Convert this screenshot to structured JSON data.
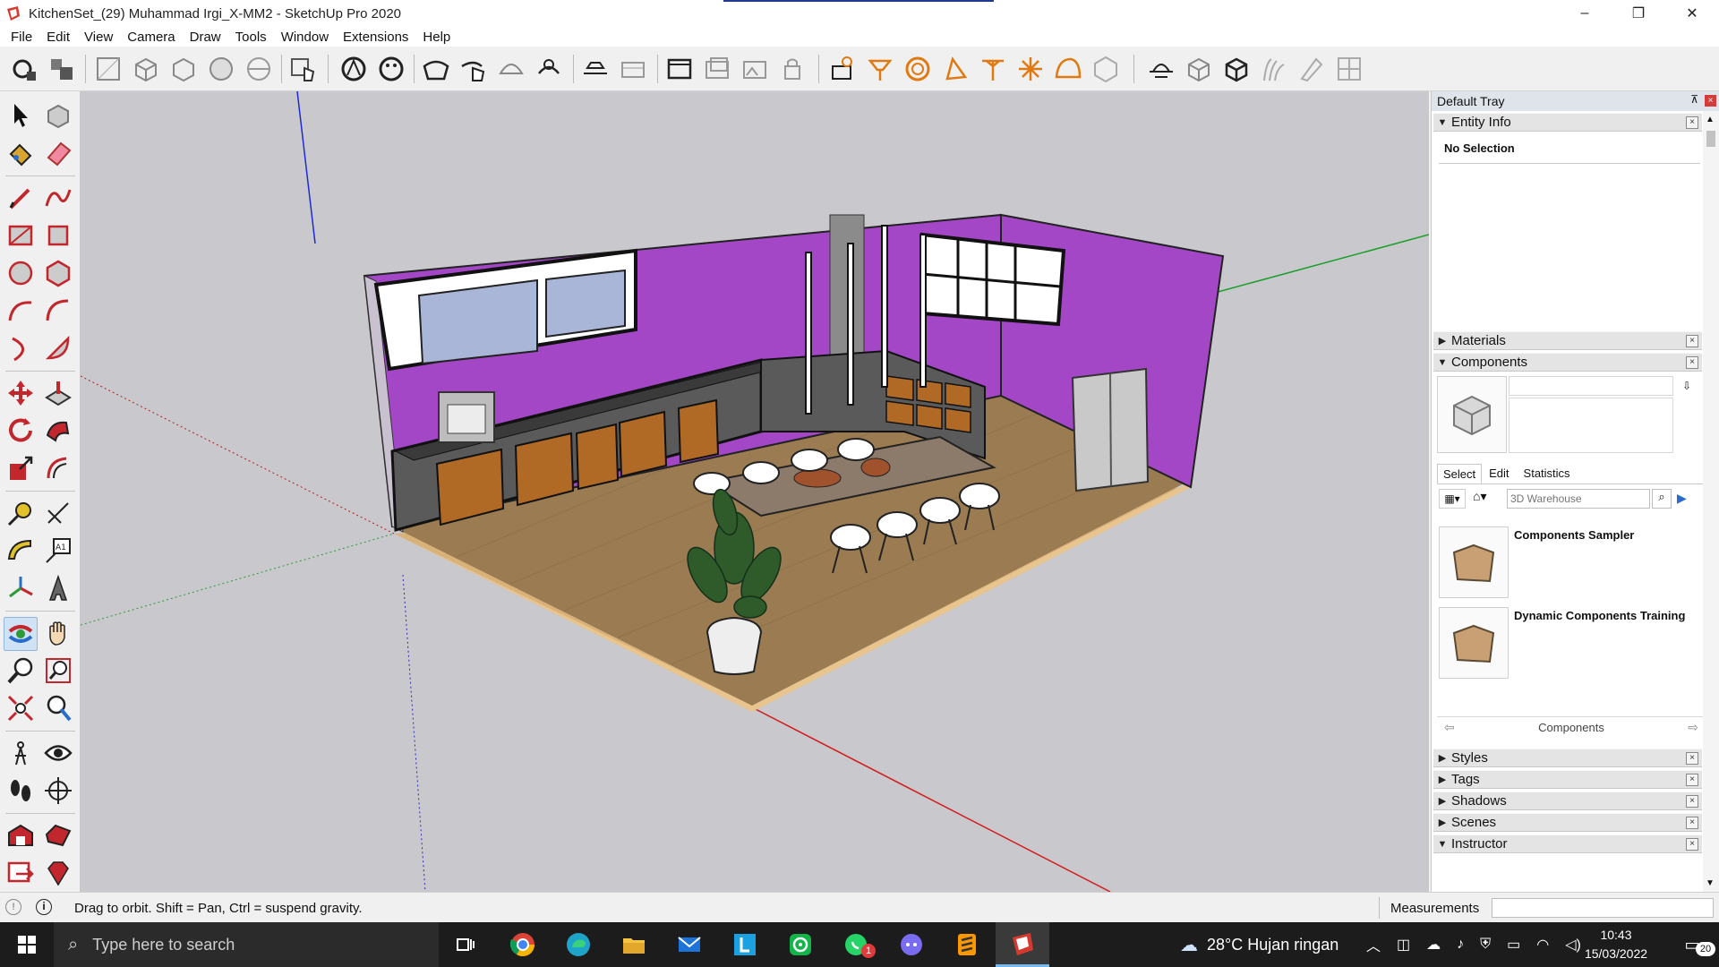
{
  "window": {
    "title": "KitchenSet_(29) Muhammad Irgi_X-MM2 - SketchUp Pro 2020",
    "controls": [
      "–",
      "❐",
      "✕"
    ]
  },
  "menu": [
    "File",
    "Edit",
    "View",
    "Camera",
    "Draw",
    "Tools",
    "Window",
    "Extensions",
    "Help"
  ],
  "tray": {
    "title": "Default Tray",
    "entity_info": {
      "label": "Entity Info",
      "selection": "No Selection"
    },
    "materials": "Materials",
    "components": {
      "label": "Components",
      "tabs": [
        "Select",
        "Edit",
        "Statistics"
      ],
      "search_placeholder": "3D Warehouse",
      "items": [
        "Components Sampler",
        "Dynamic Components Training"
      ],
      "footer": "Components"
    },
    "collapsed": [
      "Styles",
      "Tags",
      "Shadows",
      "Scenes"
    ],
    "instructor": "Instructor",
    "close_glyph": "×"
  },
  "status": {
    "hint": "Drag to orbit. Shift = Pan, Ctrl = suspend gravity.",
    "measurements_label": "Measurements"
  },
  "taskbar": {
    "search_placeholder": "Type here to search",
    "weather": "28°C  Hujan ringan",
    "time": "10:43",
    "date": "15/03/2022",
    "notifications": "20",
    "whatsapp_badge": "1"
  },
  "colors": {
    "accent": "#0078d7",
    "wall": "#a347c7",
    "floor": "#9a7b52",
    "cabinet_wood": "#b06a26",
    "viewport_bg": "#c8c8cd"
  }
}
